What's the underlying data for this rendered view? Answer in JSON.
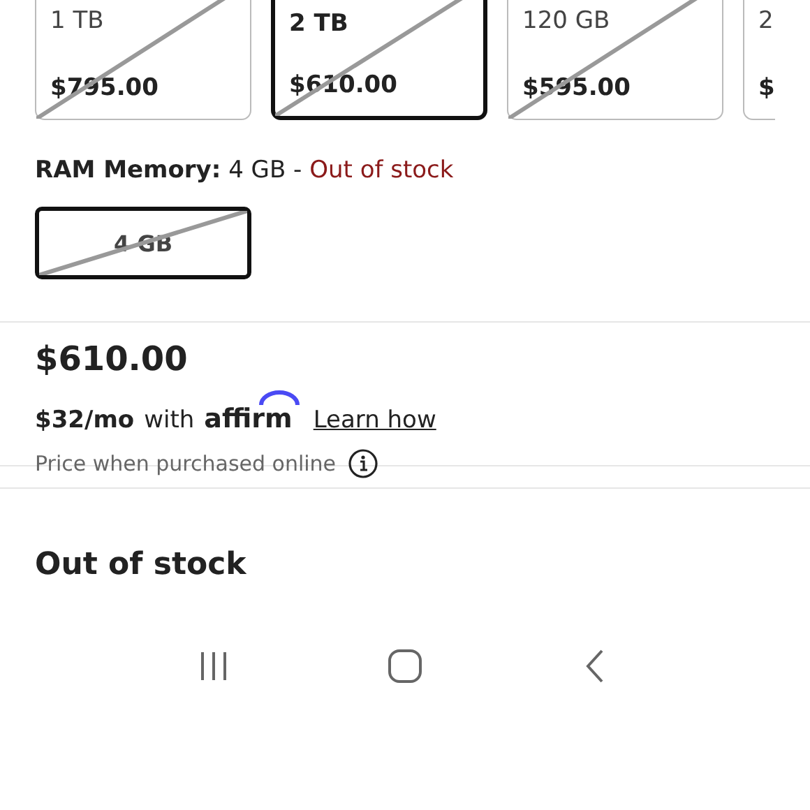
{
  "storage_options": [
    {
      "label": "1 TB",
      "price": "$795.00",
      "selected": false,
      "out_of_stock": true
    },
    {
      "label": "2 TB",
      "price": "$610.00",
      "selected": true,
      "out_of_stock": true
    },
    {
      "label": "120 GB",
      "price": "$595.00",
      "selected": false,
      "out_of_stock": true
    },
    {
      "label": "2",
      "price": "$",
      "selected": false,
      "out_of_stock": false
    }
  ],
  "ram": {
    "label": "RAM Memory:",
    "value": "4 GB",
    "separator": "-",
    "status": "Out of stock",
    "options": [
      {
        "label": "4 GB",
        "selected": true,
        "out_of_stock": true
      }
    ]
  },
  "price": {
    "amount": "$610.00",
    "monthly": "$32/mo",
    "with": "with",
    "lender": "affirm",
    "link": "Learn how",
    "note": "Price when purchased online"
  },
  "availability": "Out of stock"
}
